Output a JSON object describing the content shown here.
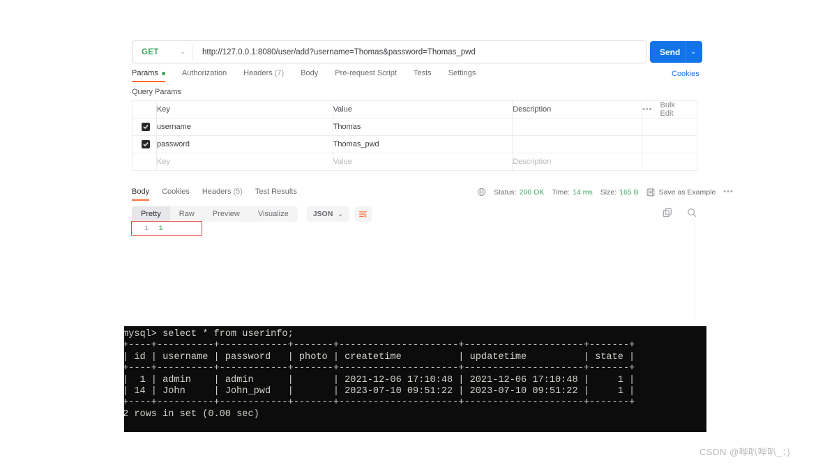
{
  "request": {
    "method": "GET",
    "url": "http://127.0.0.1:8080/user/add?username=Thomas&password=Thomas_pwd",
    "send_label": "Send",
    "method_caret": "⌄",
    "send_caret": "⌄"
  },
  "request_tabs": [
    {
      "label": "Params",
      "has_dot": true,
      "active": true
    },
    {
      "label": "Authorization",
      "active": false
    },
    {
      "label": "Headers",
      "count": "(7)",
      "active": false
    },
    {
      "label": "Body",
      "active": false
    },
    {
      "label": "Pre-request Script",
      "active": false
    },
    {
      "label": "Tests",
      "active": false
    },
    {
      "label": "Settings",
      "active": false
    }
  ],
  "cookies_link": "Cookies",
  "query_params": {
    "title": "Query Params",
    "columns": {
      "key": "Key",
      "value": "Value",
      "description": "Description"
    },
    "bulk_edit": "Bulk Edit",
    "overflow_dots": "•••",
    "rows": [
      {
        "checked": true,
        "key": "username",
        "value": "Thomas",
        "description": ""
      },
      {
        "checked": true,
        "key": "password",
        "value": "Thomas_pwd",
        "description": ""
      }
    ],
    "placeholder_row": {
      "key": "Key",
      "value": "Value",
      "description": "Description"
    }
  },
  "response_tabs": [
    {
      "label": "Body",
      "active": true
    },
    {
      "label": "Cookies",
      "active": false
    },
    {
      "label": "Headers",
      "count": "(5)",
      "active": false
    },
    {
      "label": "Test Results",
      "active": false
    }
  ],
  "status": {
    "status_label": "Status:",
    "status_value": "200 OK",
    "time_label": "Time:",
    "time_value": "14 ms",
    "size_label": "Size:",
    "size_value": "165 B",
    "save_as_example": "Save as Example",
    "overflow_dots": "•••"
  },
  "view_modes": [
    {
      "label": "Pretty",
      "active": true
    },
    {
      "label": "Raw",
      "active": false
    },
    {
      "label": "Preview",
      "active": false
    },
    {
      "label": "Visualize",
      "active": false
    }
  ],
  "format_select": {
    "value": "JSON",
    "caret": "⌄"
  },
  "response_body": {
    "line_number": "1",
    "content": "1"
  },
  "terminal": {
    "text": "mysql> select * from userinfo;\n+----+----------+------------+-------+---------------------+---------------------+-------+\n| id | username | password   | photo | createtime          | updatetime          | state |\n+----+----------+------------+-------+---------------------+---------------------+-------+\n|  1 | admin    | admin      |       | 2021-12-06 17:10:48 | 2021-12-06 17:10:48 |     1 |\n| 14 | John     | John_pwd   |       | 2023-07-10 09:51:22 | 2023-07-10 09:51:22 |     1 |\n+----+----------+------------+-------+---------------------+---------------------+-------+\n2 rows in set (0.00 sec)"
  },
  "watermark": "CSDN @哔叭哔叭_：)",
  "colors": {
    "accent_orange": "#ff6c37",
    "send_blue": "#1274e8",
    "success_green": "#3ba55c",
    "link_blue": "#1774e8",
    "highlight_red": "#e8473f"
  }
}
